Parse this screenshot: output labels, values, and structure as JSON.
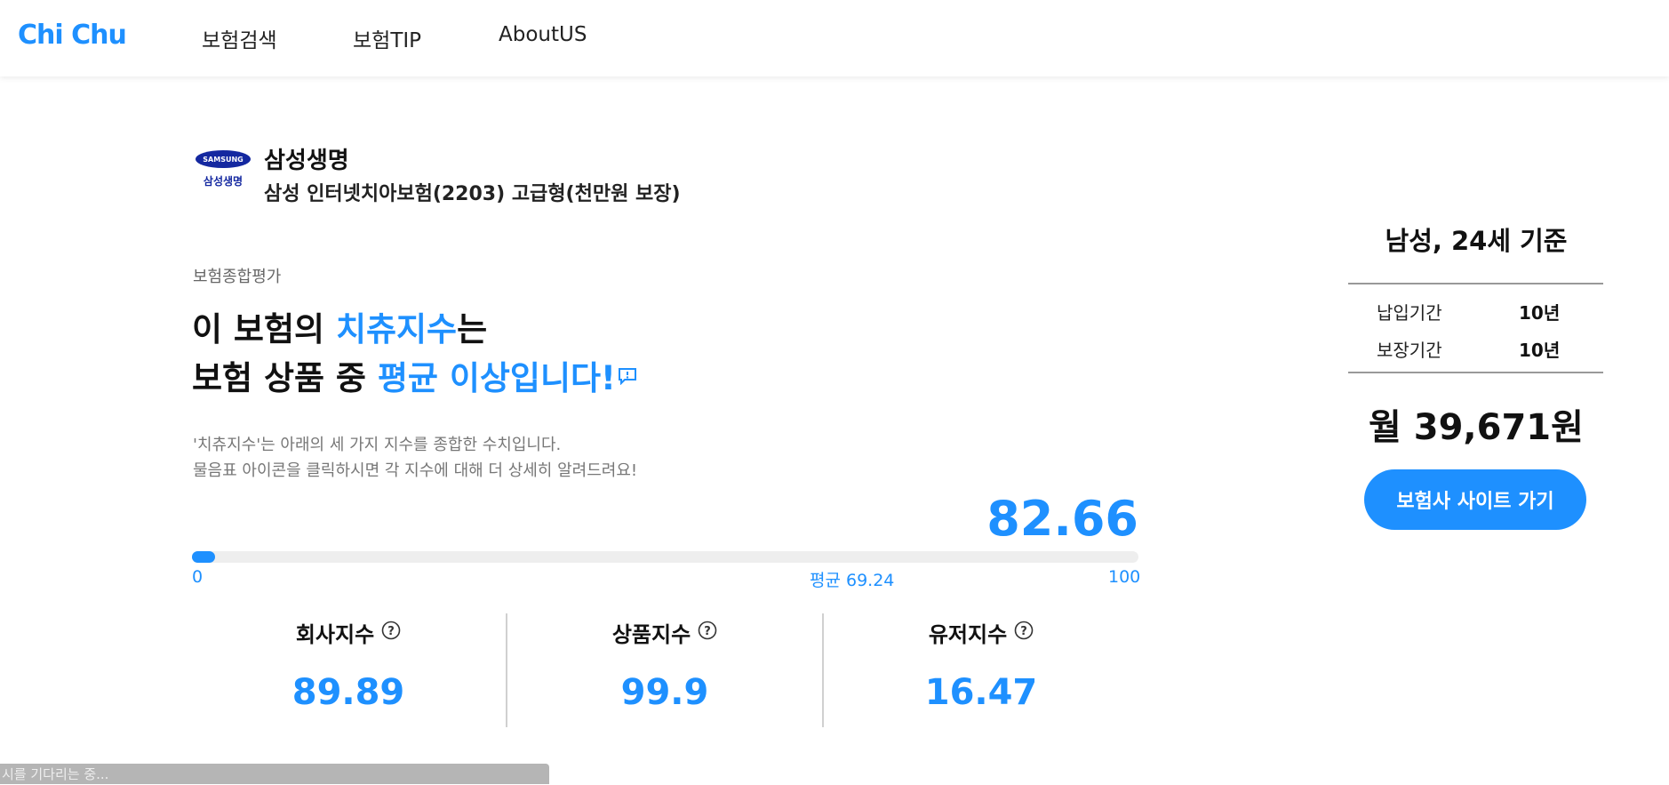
{
  "nav": {
    "logo": "Chi Chu",
    "items": [
      "보험검색",
      "보험TIP",
      "AboutUS"
    ]
  },
  "product": {
    "company_logo_text": "SAMSUNG",
    "company_logo_subtext": "삼성생명",
    "company": "삼성생명",
    "name": "삼성 인터넷치아보험(2203) 고급형(천만원 보장)"
  },
  "evaluation": {
    "label": "보험종합평가",
    "headline_1_pre": "이 보험의 ",
    "headline_1_hl": "치츄지수",
    "headline_1_post": "는",
    "headline_2_pre": "보험 상품 중 ",
    "headline_2_hl": "평균 이상입니다!",
    "desc_1": "'치츄지수'는 아래의 세 가지 지수를 종합한 수치입니다.",
    "desc_2": "물음표 아이콘을 클릭하시면 각 지수에 대해 더 상세히 알려드려요!",
    "score": "82.66",
    "progress_fraction": 0.024,
    "min_label": "0",
    "avg_label": "평균 69.24",
    "max_label": "100"
  },
  "sub_scores": [
    {
      "title": "회사지수",
      "value": "89.89"
    },
    {
      "title": "상품지수",
      "value": "99.9"
    },
    {
      "title": "유저지수",
      "value": "16.47"
    }
  ],
  "side": {
    "basis": "남성, 24세 기준",
    "rows": [
      {
        "label": "납입기간",
        "value": "10년"
      },
      {
        "label": "보장기간",
        "value": "10년"
      }
    ],
    "price": "월 39,671원",
    "button": "보험사 사이트 가기"
  },
  "status_bar": "시를 기다리는 중...",
  "colors": {
    "accent": "#1e90ff",
    "samsung_blue": "#1428a0"
  }
}
